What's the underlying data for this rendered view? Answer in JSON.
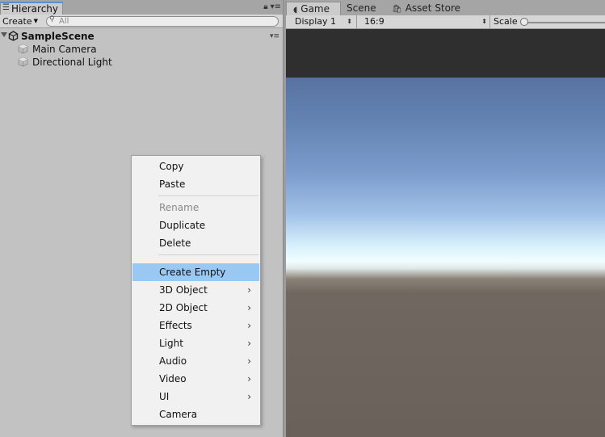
{
  "hierarchy": {
    "tab_label": "Hierarchy",
    "tab_icon": "list-icon",
    "create_label": "Create",
    "search_placeholder": "All",
    "scene_name": "SampleScene",
    "items": [
      {
        "label": "Main Camera"
      },
      {
        "label": "Directional Light"
      }
    ]
  },
  "game": {
    "tabs": [
      {
        "label": "Game",
        "icon": "pacman-icon"
      },
      {
        "label": "Scene"
      },
      {
        "label": "Asset Store",
        "icon": "bag-icon"
      }
    ],
    "display_value": "Display 1",
    "aspect_value": "16:9",
    "scale_label": "Scale"
  },
  "context_menu": {
    "items": [
      {
        "label": "Copy",
        "enabled": true
      },
      {
        "label": "Paste",
        "enabled": true
      },
      {
        "label": "Rename",
        "enabled": false
      },
      {
        "label": "Duplicate",
        "enabled": true
      },
      {
        "label": "Delete",
        "enabled": true
      },
      {
        "label": "Create Empty",
        "enabled": true,
        "highlighted": true
      },
      {
        "label": "3D Object",
        "submenu": true
      },
      {
        "label": "2D Object",
        "submenu": true
      },
      {
        "label": "Effects",
        "submenu": true
      },
      {
        "label": "Light",
        "submenu": true
      },
      {
        "label": "Audio",
        "submenu": true
      },
      {
        "label": "Video",
        "submenu": true
      },
      {
        "label": "UI",
        "submenu": true
      },
      {
        "label": "Camera",
        "enabled": true
      }
    ],
    "submenu_arrow": "›"
  },
  "colors": {
    "highlight": "#99c9f3",
    "tab_accent": "#5a8ed8",
    "sky_top": "#5872a0",
    "ground": "#6a625a"
  }
}
